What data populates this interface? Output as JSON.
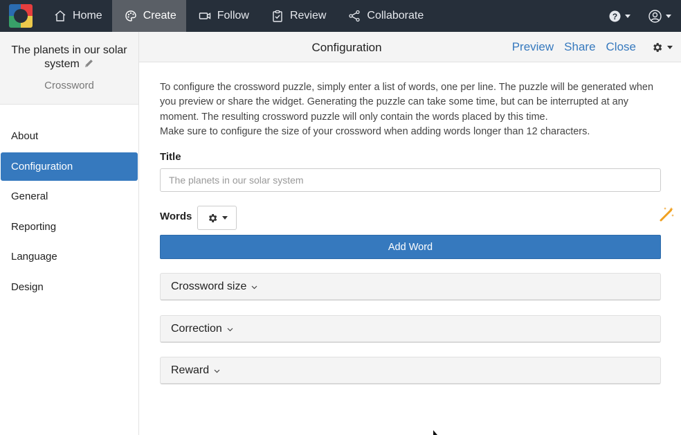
{
  "nav": {
    "items": [
      {
        "label": "Home",
        "icon": "home-icon"
      },
      {
        "label": "Create",
        "icon": "palette-icon",
        "active": true
      },
      {
        "label": "Follow",
        "icon": "video-icon"
      },
      {
        "label": "Review",
        "icon": "clipboard-icon"
      },
      {
        "label": "Collaborate",
        "icon": "share-icon"
      }
    ],
    "right": [
      {
        "icon": "help-icon"
      },
      {
        "icon": "user-icon"
      }
    ]
  },
  "sidebar": {
    "title": "The planets in our solar system",
    "subtitle": "Crossword",
    "items": [
      {
        "label": "About"
      },
      {
        "label": "Configuration",
        "active": true
      },
      {
        "label": "General"
      },
      {
        "label": "Reporting"
      },
      {
        "label": "Language"
      },
      {
        "label": "Design"
      }
    ]
  },
  "header": {
    "title": "Configuration",
    "preview": "Preview",
    "share": "Share",
    "close": "Close"
  },
  "main": {
    "intro_line1": "To configure the crossword puzzle, simply enter a list of words, one per line. The puzzle will be generated when you preview or share the widget. Generating the puzzle can take some time, but can be interrupted at any moment. The resulting crossword puzzle will only contain the words placed by this time.",
    "intro_line2": "Make sure to configure the size of your crossword when adding words longer than 12 characters.",
    "title_label": "Title",
    "title_placeholder": "The planets in our solar system",
    "words_label": "Words",
    "add_word": "Add Word",
    "panels": [
      {
        "label": "Crossword size"
      },
      {
        "label": "Correction"
      },
      {
        "label": "Reward"
      }
    ]
  },
  "colors": {
    "nav_bg": "#262f3a",
    "accent": "#3679be",
    "wand": "#f0a020"
  }
}
